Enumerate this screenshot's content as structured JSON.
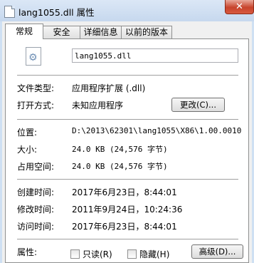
{
  "window": {
    "title": "lang1055.dll 属性",
    "close_glyph": "✕"
  },
  "tabs": [
    {
      "label": "常规",
      "active": true
    },
    {
      "label": "安全",
      "active": false
    },
    {
      "label": "详细信息",
      "active": false
    },
    {
      "label": "以前的版本",
      "active": false
    }
  ],
  "file": {
    "name": "lang1055.dll",
    "icon": "dll-gear-file-icon"
  },
  "type_info": {
    "file_type_label": "文件类型:",
    "file_type_value": "应用程序扩展 (.dll)",
    "opens_with_label": "打开方式:",
    "opens_with_value": "未知应用程序",
    "change_button": "更改(C)..."
  },
  "location_info": {
    "location_label": "位置:",
    "location_value": "D:\\2013\\62301\\lang1055\\X86\\1.00.0010",
    "size_label": "大小:",
    "size_value": "24.0 KB (24,576 字节)",
    "size_on_disk_label": "占用空间:",
    "size_on_disk_value": "24.0 KB (24,576 字节)"
  },
  "dates": {
    "created_label": "创建时间:",
    "created_value": "2017年6月23日，8:44:01",
    "modified_label": "修改时间:",
    "modified_value": "2011年9月24日，10:24:36",
    "accessed_label": "访问时间:",
    "accessed_value": "2017年6月23日，8:44:01"
  },
  "attributes": {
    "label": "属性:",
    "readonly_label": "只读(R)",
    "readonly_checked": false,
    "hidden_label": "隐藏(H)",
    "hidden_checked": false,
    "advanced_button": "高级(D)..."
  }
}
